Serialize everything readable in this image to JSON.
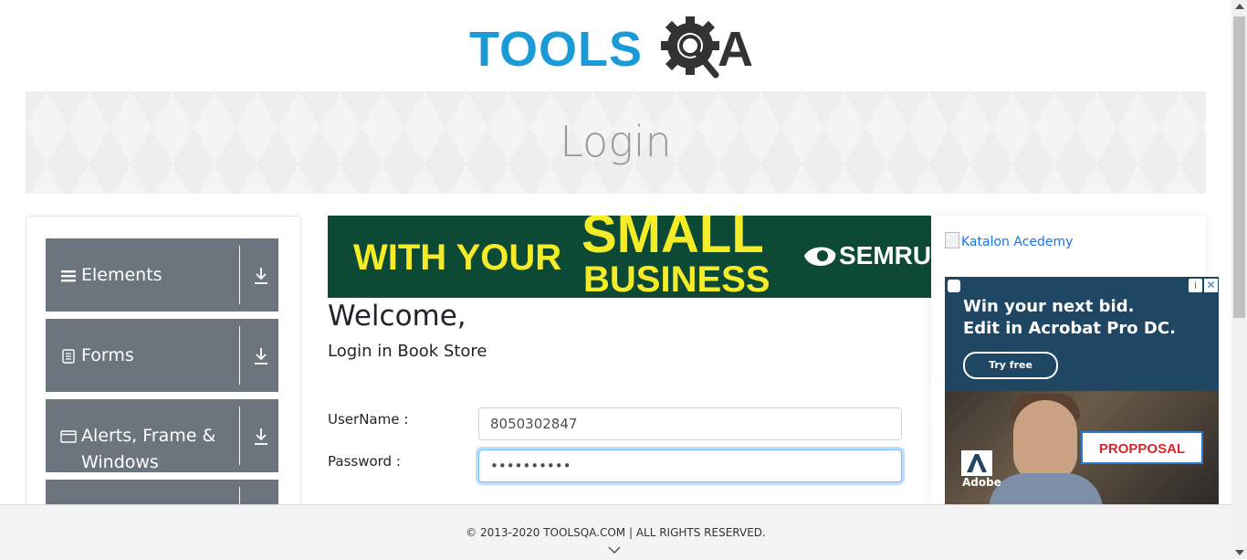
{
  "brand": {
    "logo_text": "TOOLS",
    "logo_suffix": "A"
  },
  "banner": {
    "title": "Login"
  },
  "sidebar": {
    "groups": [
      {
        "label": "Elements",
        "icon": "hamburger-icon"
      },
      {
        "label": "Forms",
        "icon": "document-icon"
      },
      {
        "label": "Alerts, Frame & Windows",
        "icon": "window-icon"
      },
      {
        "label": "",
        "icon": "download-icon"
      }
    ]
  },
  "top_ad": {
    "line1": "WITH YOUR",
    "line2": "SMALL",
    "line3": "BUSINESS",
    "brand": "SEMRU"
  },
  "main": {
    "welcome": "Welcome,",
    "subheading": "Login in Book Store",
    "username_label": "UserName :",
    "username_value": "8050302847",
    "password_label": "Password :",
    "password_value": "••••••••••"
  },
  "right": {
    "katalon_alt": "Katalon Acedemy",
    "adobe_ad": {
      "line1": "Win your next bid.",
      "line2": "Edit in Acrobat Pro DC.",
      "cta": "Try free",
      "proposal": "PROPPOSAL",
      "brand": "Adobe",
      "info": "i",
      "close": "✕"
    }
  },
  "footer": {
    "copyright": "© 2013-2020 TOOLSQA.COM | ALL RIGHTS RESERVED."
  },
  "colors": {
    "sidebar_group": "#6c757d",
    "brand_blue": "#1a9bd8",
    "semrush_bg": "#0d4a35",
    "semrush_yellow": "#f5ec28",
    "adobe_bg": "#1f4663"
  }
}
